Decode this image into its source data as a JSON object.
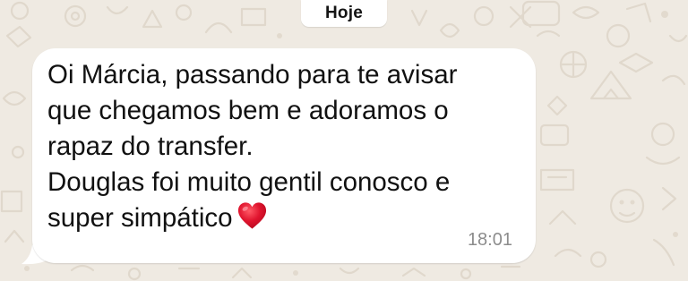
{
  "chat": {
    "date_separator": "Hoje",
    "message": {
      "lines": [
        "Oi Márcia, passando para te avisar",
        "que chegamos bem e adoramos o",
        "rapaz do transfer.",
        "Douglas foi muito gentil conosco e",
        "super simpático"
      ],
      "emoji": "heart-emoji",
      "time": "18:01",
      "direction": "incoming"
    }
  },
  "colors": {
    "wallpaper": "#efeae2",
    "bubble": "#ffffff",
    "text": "#111111",
    "timestamp": "#8c8c8c",
    "heart": "#e0142e"
  }
}
